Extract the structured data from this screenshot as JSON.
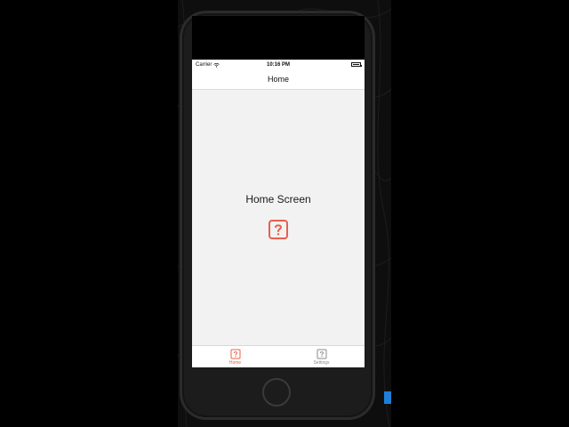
{
  "status_bar": {
    "carrier": "Carrier",
    "time": "10:16 PM",
    "wifi_icon": "wifi-icon",
    "battery_icon": "battery-icon"
  },
  "nav": {
    "title": "Home"
  },
  "content": {
    "heading": "Home Screen",
    "icon": "help-square-icon"
  },
  "tabs": [
    {
      "label": "Home",
      "icon": "help-square-icon",
      "active": true
    },
    {
      "label": "Settings",
      "icon": "help-square-icon",
      "active": false
    }
  ],
  "colors": {
    "accent": "#e8604a",
    "inactive": "#8a8a8a",
    "screen_bg": "#f2f2f2"
  }
}
